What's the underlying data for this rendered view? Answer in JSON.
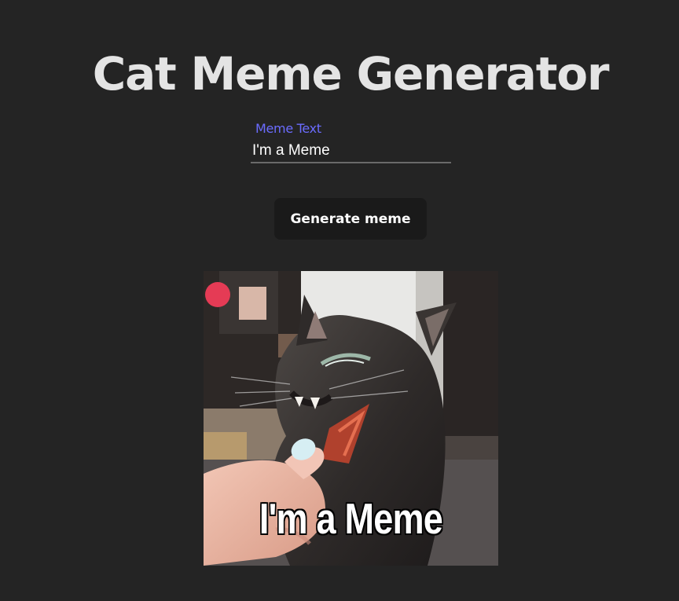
{
  "page": {
    "title": "Cat Meme Generator"
  },
  "form": {
    "label": "Meme Text",
    "value": "I'm a Meme"
  },
  "actions": {
    "generate_label": "Generate meme"
  },
  "meme": {
    "caption": "I'm a Meme"
  },
  "colors": {
    "background": "#242424",
    "title": "#e4e4e4",
    "label_accent": "#6b6cff",
    "button_bg": "#1a1a1a"
  }
}
